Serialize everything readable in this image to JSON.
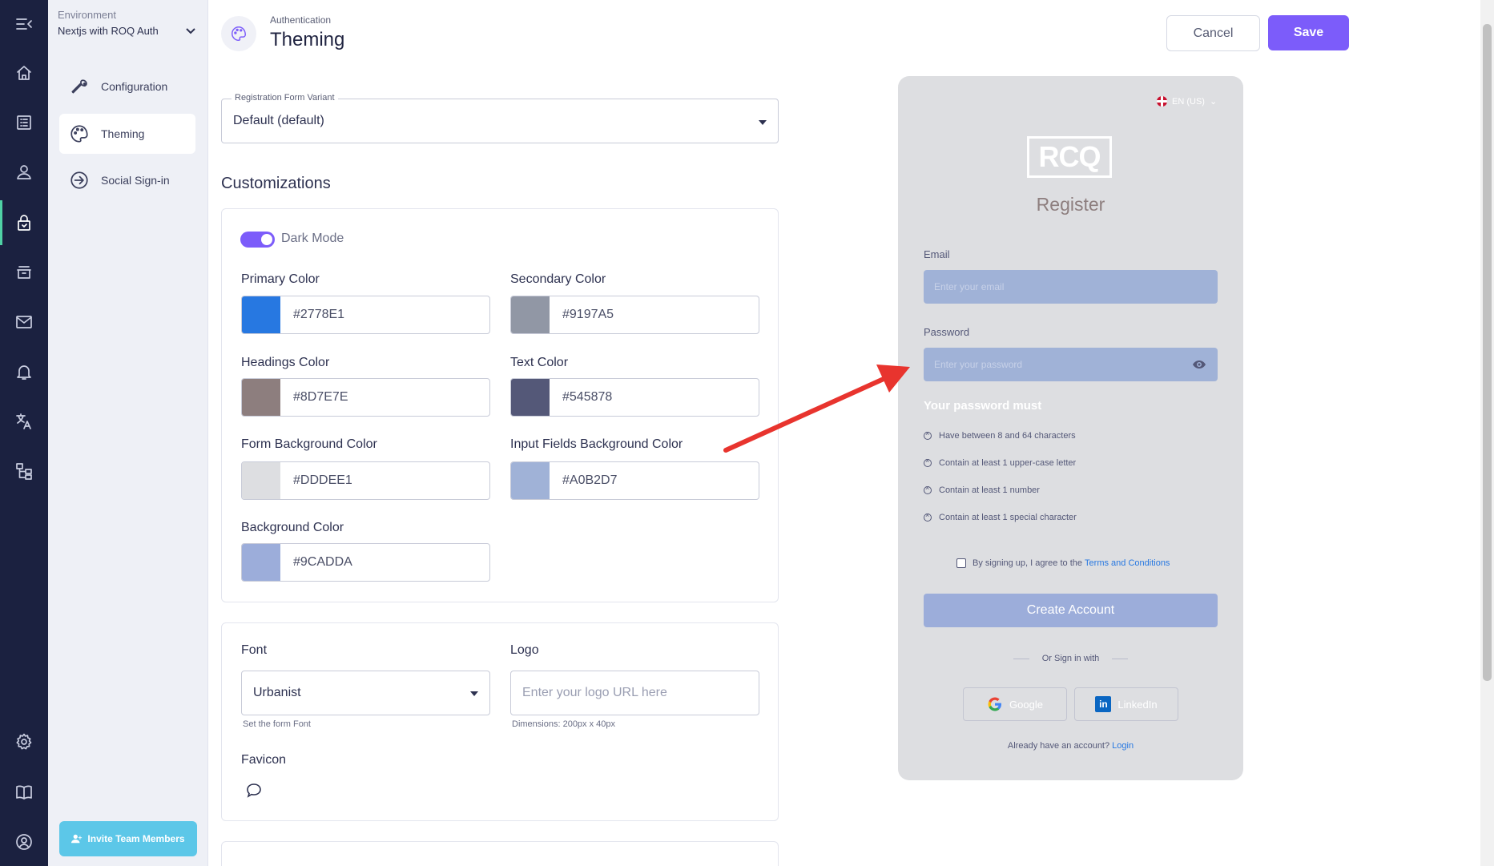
{
  "sidebar": {
    "environment_label": "Environment",
    "environment_value": "Nextjs with ROQ Auth",
    "items": [
      {
        "label": "Configuration"
      },
      {
        "label": "Theming"
      },
      {
        "label": "Social Sign-in"
      }
    ],
    "invite_label": "Invite Team Members"
  },
  "rail": {
    "icons": [
      "menu-collapse-icon",
      "home-icon",
      "list-icon",
      "user-icon",
      "lock-icon",
      "archive-icon",
      "mail-icon",
      "bell-icon",
      "translate-icon",
      "hierarchy-icon",
      "gear-icon",
      "book-icon",
      "account-circle-icon"
    ]
  },
  "header": {
    "breadcrumb": "Authentication",
    "title": "Theming",
    "cancel_label": "Cancel",
    "save_label": "Save"
  },
  "form": {
    "variant_label": "Registration Form Variant",
    "variant_value": "Default (default)",
    "section_title": "Customizations",
    "dark_mode_label": "Dark Mode",
    "dark_mode_on": true,
    "colors": [
      {
        "label": "Primary Color",
        "hex": "#2778E1"
      },
      {
        "label": "Secondary Color",
        "hex": "#9197A5"
      },
      {
        "label": "Headings Color",
        "hex": "#8D7E7E"
      },
      {
        "label": "Text Color",
        "hex": "#545878"
      },
      {
        "label": "Form Background Color",
        "hex": "#DDDEE1"
      },
      {
        "label": "Input Fields Background Color",
        "hex": "#A0B2D7"
      },
      {
        "label": "Background Color",
        "hex": "#9CADDA"
      }
    ],
    "font_label": "Font",
    "font_value": "Urbanist",
    "font_helper": "Set the form Font",
    "logo_label": "Logo",
    "logo_placeholder": "Enter your logo URL here",
    "logo_helper": "Dimensions: 200px x 40px",
    "favicon_label": "Favicon"
  },
  "preview": {
    "language": "EN (US)",
    "logo_text": "RCQ",
    "title": "Register",
    "email_label": "Email",
    "email_placeholder": "Enter your email",
    "password_label": "Password",
    "password_placeholder": "Enter your password",
    "password_rules_title": "Your password must",
    "password_rules": [
      "Have between 8 and 64 characters",
      "Contain at least 1 upper-case letter",
      "Contain at least 1 number",
      "Contain at least 1 special character"
    ],
    "terms_prefix": "By signing up, I agree to the ",
    "terms_link": "Terms and Conditions",
    "create_label": "Create Account",
    "or_label": "Or Sign in with",
    "google_label": "Google",
    "linkedin_label": "LinkedIn",
    "already_prefix": "Already have an account? ",
    "login_link": "Login"
  },
  "colors": {
    "accent": "#7c5cfa",
    "rail_bg": "#1b2140",
    "annotation_arrow": "#e8342e"
  }
}
